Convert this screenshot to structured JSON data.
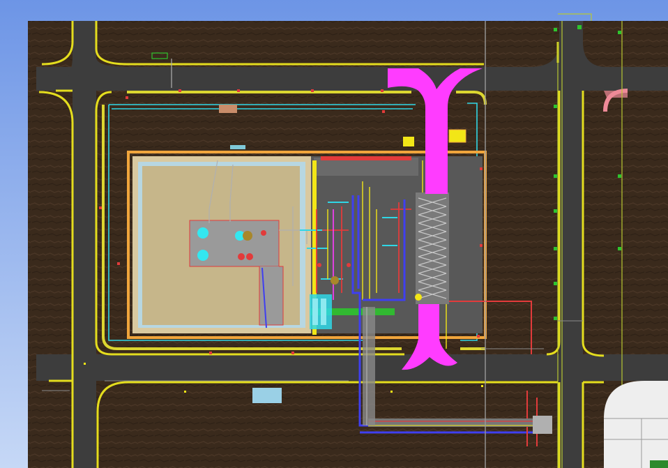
{
  "viewport": {
    "background_top": "#6d95e6",
    "background_bottom": "#c6d8f6"
  },
  "colors": {
    "soil": "#3a2a1c",
    "soil_texture": "#4a3626",
    "road": "#3d3d3d",
    "road_edge": "#e4dd1e",
    "curb": "#dcd630",
    "building_outline": "#f0a53c",
    "slab": "#c6b68a",
    "slab_frame": "#b7d7e2",
    "equipment_floor": "#585858",
    "process_pipe": "#ff3cff",
    "cable_tray": "#3f3ff0",
    "cyan_line": "#2fd7e6",
    "red_line": "#e23b3b",
    "grid_line": "#b8c832",
    "white_plot": "#eeeeee",
    "gray_pipe": "#b0b0b0",
    "marker_red": "#e23b3b",
    "marker_yellow": "#f2e617",
    "marker_green": "#2ec42e",
    "tank_cyan": "#33e7f0",
    "pump_brown": "#a8872a",
    "pink_curve": "#ef8a98"
  },
  "icons": {
    "tank": "tank-icon",
    "pump": "pump-icon",
    "heat_exchanger": "heat-exchanger-icon",
    "survey_marker": "survey-marker-icon"
  }
}
